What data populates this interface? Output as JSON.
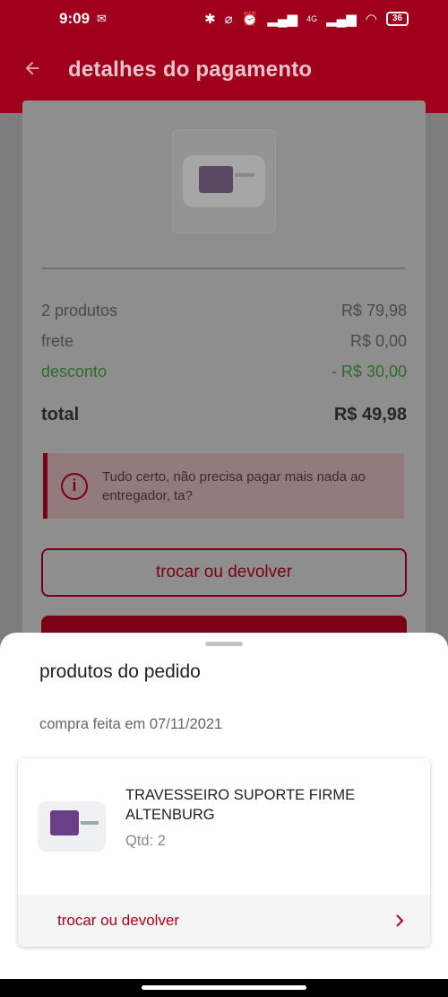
{
  "status_bar": {
    "time": "9:09",
    "battery": "36",
    "network": "4G",
    "icons": [
      "message-icon",
      "bluetooth-icon",
      "vibrate-off-icon",
      "alarm-icon",
      "signal-icon",
      "signal-icon",
      "wifi-icon",
      "battery-icon"
    ]
  },
  "app_bar": {
    "title": "detalhes do pagamento",
    "back_icon": "arrow-left-icon"
  },
  "summary": {
    "products_label": "2 produtos",
    "products_value": "R$ 79,98",
    "shipping_label": "frete",
    "shipping_value": "R$ 0,00",
    "discount_label": "desconto",
    "discount_value": "- R$ 30,00",
    "total_label": "total",
    "total_value": "R$ 49,98"
  },
  "alert": {
    "text": "Tudo certo, não precisa pagar mais nada ao entregador, ta?",
    "icon": "info-icon"
  },
  "buttons": {
    "exchange_return": "trocar ou devolver"
  },
  "sheet": {
    "title": "produtos do pedido",
    "date": "compra feita em 07/11/2021",
    "item": {
      "name": "TRAVESSEIRO SUPORTE FIRME ALTENBURG",
      "qty": "Qtd: 2",
      "action": "trocar ou devolver"
    }
  },
  "colors": {
    "brand": "#b3001e",
    "discount": "#2e8b2e"
  }
}
